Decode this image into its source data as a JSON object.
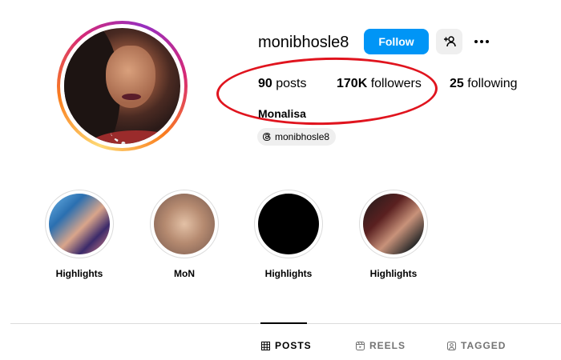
{
  "profile": {
    "username": "monibhosle8",
    "follow_label": "Follow",
    "full_name": "Monalisa",
    "threads_handle": "monibhosle8"
  },
  "stats": {
    "posts_count": "90",
    "posts_label": " posts",
    "followers_count": "170K",
    "followers_label": " followers",
    "following_count": "25",
    "following_label": " following"
  },
  "highlights": [
    {
      "label": "Highlights"
    },
    {
      "label": "MoN"
    },
    {
      "label": "Highlights"
    },
    {
      "label": "Highlights"
    }
  ],
  "tabs": {
    "posts": "POSTS",
    "reels": "REELS",
    "tagged": "TAGGED"
  },
  "colors": {
    "follow_button": "#0095f6",
    "annotation_oval": "#e0141e"
  },
  "icons": [
    "add-user-icon",
    "more-options-icon",
    "threads-icon",
    "grid-icon",
    "reels-icon",
    "tagged-icon"
  ]
}
